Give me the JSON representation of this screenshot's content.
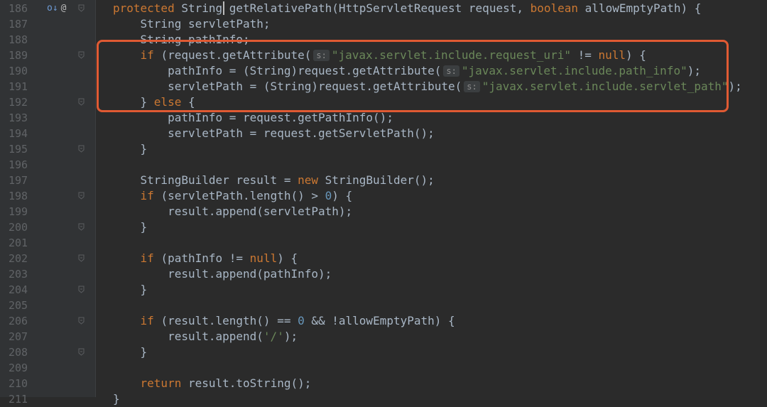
{
  "editor": {
    "lines": [
      {
        "n": "186",
        "tokens": [
          [
            "kw",
            "protected "
          ],
          [
            "",
            "String "
          ],
          [
            "",
            "getRelativePath(HttpServletRequest request, "
          ],
          [
            "kw",
            "boolean "
          ],
          [
            "",
            "allowEmptyPath) {"
          ]
        ]
      },
      {
        "n": "187",
        "tokens": [
          [
            "",
            "    String servletPath;"
          ]
        ]
      },
      {
        "n": "188",
        "tokens": [
          [
            "",
            "    String pathInfo;"
          ]
        ]
      },
      {
        "n": "189",
        "tokens": [
          [
            "",
            "    "
          ],
          [
            "kw",
            "if "
          ],
          [
            "",
            "(request.getAttribute("
          ],
          [
            "hint",
            "s:"
          ],
          [
            "str",
            "\"javax.servlet.include.request_uri\""
          ],
          [
            "",
            " != "
          ],
          [
            "kw",
            "null"
          ],
          [
            "",
            ") {"
          ]
        ]
      },
      {
        "n": "190",
        "tokens": [
          [
            "",
            "        pathInfo = (String)request.getAttribute("
          ],
          [
            "hint",
            "s:"
          ],
          [
            "str",
            "\"javax.servlet.include.path_info\""
          ],
          [
            "",
            ");"
          ]
        ]
      },
      {
        "n": "191",
        "tokens": [
          [
            "",
            "        servletPath = (String)request.getAttribute("
          ],
          [
            "hint",
            "s:"
          ],
          [
            "str",
            "\"javax.servlet.include.servlet_path\""
          ],
          [
            "",
            ");"
          ]
        ]
      },
      {
        "n": "192",
        "tokens": [
          [
            "",
            "    } "
          ],
          [
            "kw",
            "else "
          ],
          [
            "",
            "{"
          ]
        ]
      },
      {
        "n": "193",
        "tokens": [
          [
            "",
            "        pathInfo = request.getPathInfo();"
          ]
        ]
      },
      {
        "n": "194",
        "tokens": [
          [
            "",
            "        servletPath = request.getServletPath();"
          ]
        ]
      },
      {
        "n": "195",
        "tokens": [
          [
            "",
            "    }"
          ]
        ]
      },
      {
        "n": "196",
        "tokens": [
          [
            "",
            ""
          ]
        ]
      },
      {
        "n": "197",
        "tokens": [
          [
            "",
            "    StringBuilder result = "
          ],
          [
            "kw",
            "new "
          ],
          [
            "",
            "StringBuilder();"
          ]
        ]
      },
      {
        "n": "198",
        "tokens": [
          [
            "",
            "    "
          ],
          [
            "kw",
            "if "
          ],
          [
            "",
            "(servletPath.length() > "
          ],
          [
            "num",
            "0"
          ],
          [
            "",
            ") {"
          ]
        ]
      },
      {
        "n": "199",
        "tokens": [
          [
            "",
            "        result.append(servletPath);"
          ]
        ]
      },
      {
        "n": "200",
        "tokens": [
          [
            "",
            "    }"
          ]
        ]
      },
      {
        "n": "201",
        "tokens": [
          [
            "",
            ""
          ]
        ]
      },
      {
        "n": "202",
        "tokens": [
          [
            "",
            "    "
          ],
          [
            "kw",
            "if "
          ],
          [
            "",
            "(pathInfo != "
          ],
          [
            "kw",
            "null"
          ],
          [
            "",
            ") {"
          ]
        ]
      },
      {
        "n": "203",
        "tokens": [
          [
            "",
            "        result.append(pathInfo);"
          ]
        ]
      },
      {
        "n": "204",
        "tokens": [
          [
            "",
            "    }"
          ]
        ]
      },
      {
        "n": "205",
        "tokens": [
          [
            "",
            ""
          ]
        ]
      },
      {
        "n": "206",
        "tokens": [
          [
            "",
            "    "
          ],
          [
            "kw",
            "if "
          ],
          [
            "",
            "(result.length() == "
          ],
          [
            "num",
            "0"
          ],
          [
            "",
            " && !allowEmptyPath) {"
          ]
        ]
      },
      {
        "n": "207",
        "tokens": [
          [
            "",
            "        result.append("
          ],
          [
            "str",
            "'/'"
          ],
          [
            "",
            ");"
          ]
        ]
      },
      {
        "n": "208",
        "tokens": [
          [
            "",
            "    }"
          ]
        ]
      },
      {
        "n": "209",
        "tokens": [
          [
            "",
            ""
          ]
        ]
      },
      {
        "n": "210",
        "tokens": [
          [
            "",
            "    "
          ],
          [
            "kw",
            "return "
          ],
          [
            "",
            "result.toString();"
          ]
        ]
      },
      {
        "n": "211",
        "tokens": [
          [
            "",
            "}"
          ]
        ]
      }
    ],
    "fold_lines": [
      "186",
      "189",
      "192",
      "195",
      "198",
      "200",
      "202",
      "204",
      "206",
      "208"
    ],
    "gutter_icons": {
      "override": "o↓",
      "annotation": "@"
    }
  },
  "colors": {
    "background": "#2b2b2b",
    "keyword": "#cc7832",
    "string": "#6a8759",
    "number": "#6897bb",
    "text": "#a9b7c6",
    "highlight_box": "#e05a33"
  }
}
